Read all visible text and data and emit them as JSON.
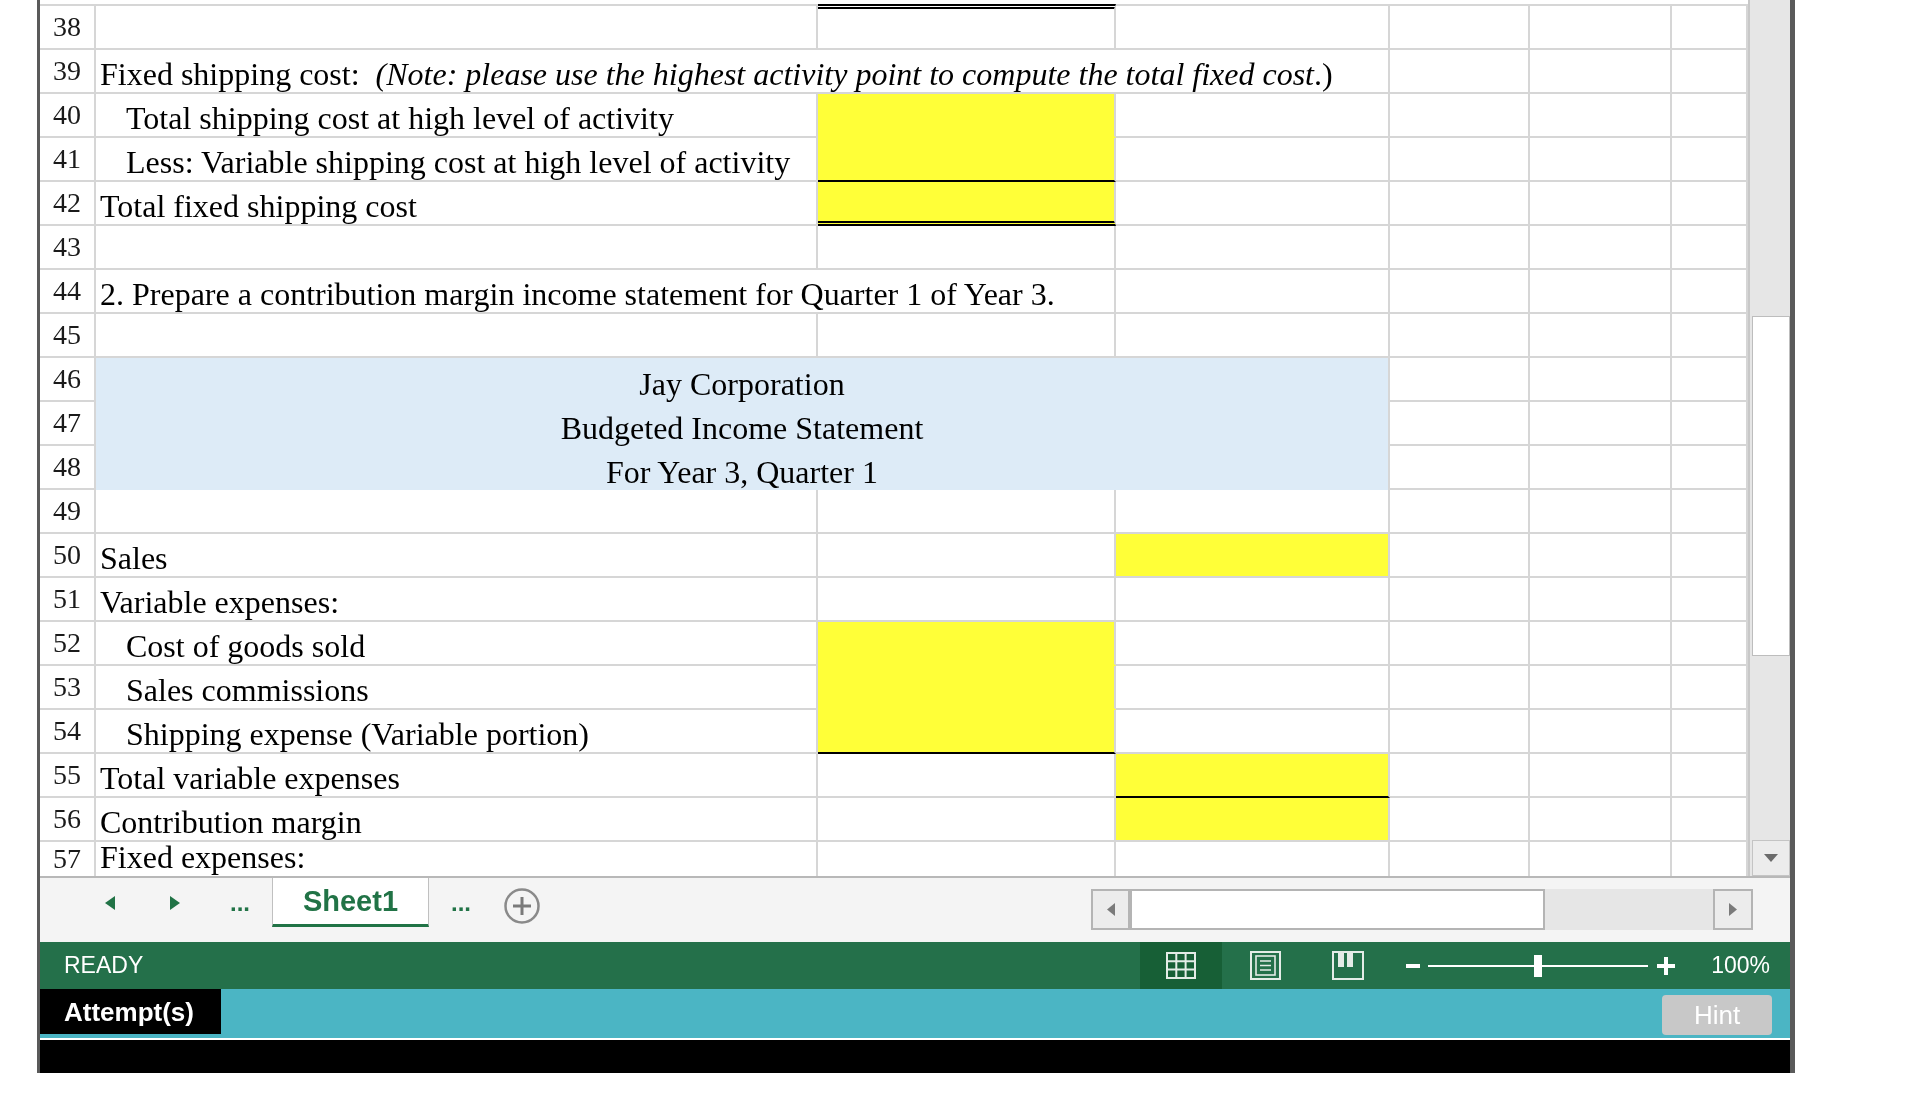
{
  "sheet": {
    "rows": [
      {
        "number": "38",
        "kind": "blank",
        "column_2": {
          "kind": "plain",
          "double_rule_above": true
        }
      },
      {
        "number": "39",
        "kind": "text",
        "text": "Fixed shipping cost:  *(Note: please use the highest activity point to compute the total fixed cost*.)"
      },
      {
        "number": "40",
        "kind": "indented",
        "text": "Total shipping cost at high level of activity",
        "column_2": {
          "kind": "answer",
          "underlined": false,
          "double_underlined": false
        }
      },
      {
        "number": "41",
        "kind": "indented",
        "text": "Less: Variable shipping cost at high level of activity",
        "column_2": {
          "kind": "answer",
          "underlined": true,
          "double_underlined": false
        }
      },
      {
        "number": "42",
        "kind": "text",
        "text": "Total fixed shipping cost",
        "column_2": {
          "kind": "answer",
          "double_underlined": true
        }
      },
      {
        "number": "43",
        "kind": "blank"
      },
      {
        "number": "44",
        "kind": "text",
        "text": "2. Prepare a contribution margin income statement for Quarter 1 of Year 3."
      },
      {
        "number": "45",
        "kind": "blank"
      },
      {
        "number": "46",
        "kind": "title",
        "text": "Jay Corporation"
      },
      {
        "number": "47",
        "kind": "title",
        "text": "Budgeted Income Statement"
      },
      {
        "number": "48",
        "kind": "title",
        "text": "For Year 3, Quarter 1"
      },
      {
        "number": "49",
        "kind": "blank"
      },
      {
        "number": "50",
        "kind": "text",
        "text": "Sales",
        "column_3": {
          "kind": "answer",
          "underlined": false,
          "double_underlined": false
        }
      },
      {
        "number": "51",
        "kind": "text",
        "text": "Variable expenses:"
      },
      {
        "number": "52",
        "kind": "indented",
        "text": "Cost of goods sold",
        "column_2": {
          "kind": "answer",
          "underlined": false,
          "double_underlined": false
        }
      },
      {
        "number": "53",
        "kind": "indented",
        "text": "Sales commissions",
        "column_2": {
          "kind": "answer",
          "underlined": false,
          "double_underlined": false
        }
      },
      {
        "number": "54",
        "kind": "indented",
        "text": "Shipping expense (Variable portion)",
        "column_2": {
          "kind": "answer",
          "underlined": true,
          "double_underlined": false
        }
      },
      {
        "number": "55",
        "kind": "text",
        "text": "Total variable expenses",
        "column_3": {
          "kind": "answer",
          "underlined": true,
          "double_underlined": false
        }
      },
      {
        "number": "56",
        "kind": "text",
        "text": "Contribution margin",
        "column_3": {
          "kind": "answer",
          "underlined": false,
          "double_underlined": false
        }
      },
      {
        "number": "57",
        "kind": "text",
        "text": "Fixed expenses:"
      }
    ]
  },
  "sheet_tabs": {
    "more_before": "...",
    "tabs": [
      {
        "label": "Sheet1",
        "selected": true
      }
    ],
    "more_after": "..."
  },
  "status_bar": {
    "status": "READY",
    "views": [
      {
        "kind": "normal",
        "selected": true
      },
      {
        "kind": "page_layout",
        "selected": false
      },
      {
        "kind": "page_break_preview",
        "selected": false
      }
    ],
    "zoom": {
      "level": 0.5,
      "reading": "100%"
    }
  },
  "attempt_bar": {
    "label": "Attempt(s)",
    "hint_button": {
      "label": "Hint",
      "disabled": true
    }
  }
}
